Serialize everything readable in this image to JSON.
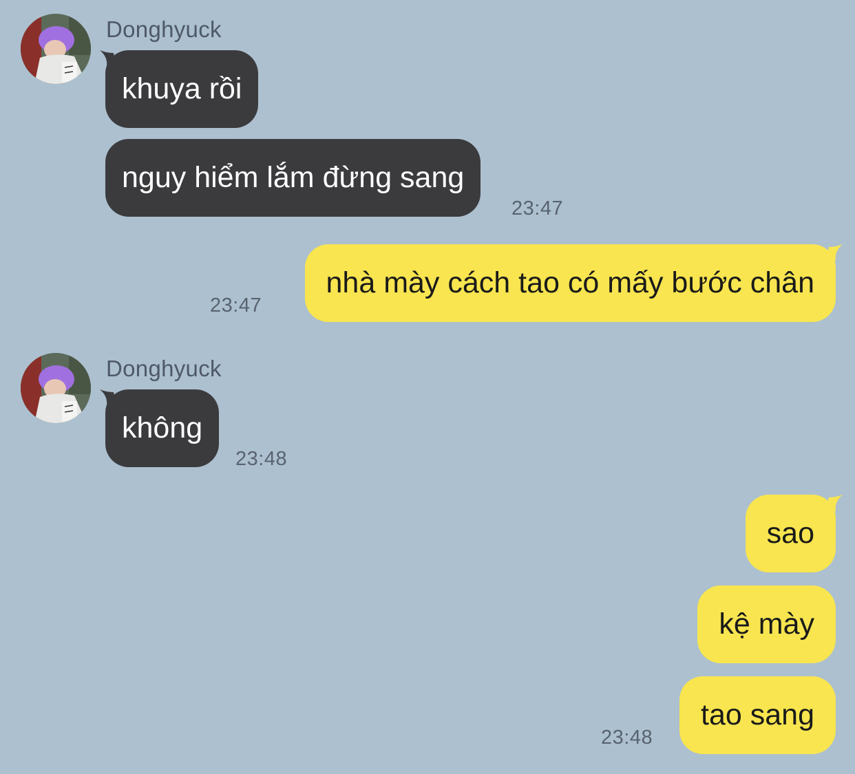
{
  "chat": {
    "contact_name": "Donghyuck",
    "avatar_icon": "profile-photo-avatar",
    "colors": {
      "background": "#adc0cf",
      "incoming_bubble": "#3b3b3e",
      "outgoing_bubble": "#f8e54f",
      "timestamp": "#58636f"
    },
    "group1": {
      "sender": "Donghyuck",
      "messages": [
        "khuya rồi",
        "nguy hiểm lắm đừng sang"
      ],
      "time": "23:47"
    },
    "group2": {
      "messages": [
        "nhà mày cách tao có mấy bước chân"
      ],
      "time": "23:47"
    },
    "group3": {
      "sender": "Donghyuck",
      "messages": [
        "không"
      ],
      "time": "23:48"
    },
    "group4": {
      "messages": [
        "sao",
        "kệ mày",
        "tao sang"
      ],
      "time": "23:48"
    }
  }
}
